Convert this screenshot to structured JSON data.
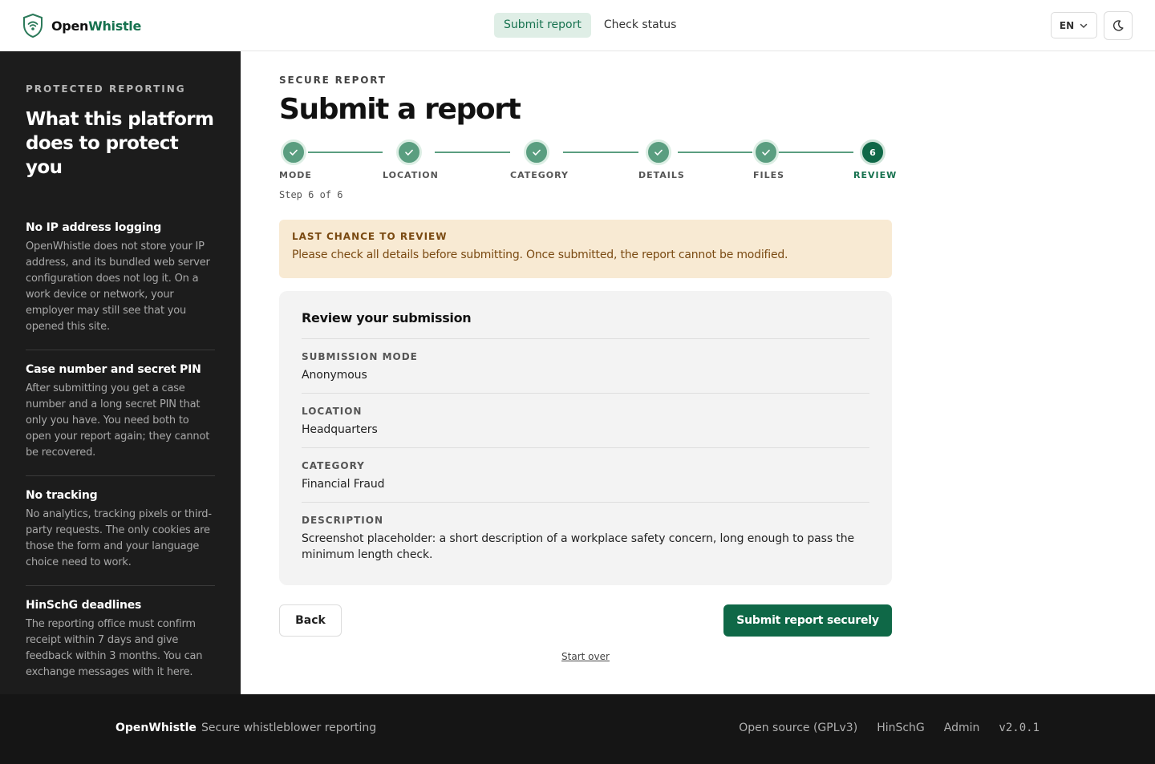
{
  "header": {
    "brand_part1": "Open",
    "brand_part2": "Whistle",
    "logo_icon": "shield-wifi-icon",
    "nav": [
      {
        "label": "Submit report",
        "active": true
      },
      {
        "label": "Check status",
        "active": false
      }
    ],
    "language": "EN",
    "theme_icon": "moon-icon"
  },
  "sidebar": {
    "eyebrow": "PROTECTED REPORTING",
    "title": "What this platform does to protect you",
    "items": [
      {
        "title": "No IP address logging",
        "body": "OpenWhistle does not store your IP address, and its bundled web server configuration does not log it. On a work device or network, your employer may still see that you opened this site."
      },
      {
        "title": "Case number and secret PIN",
        "body": "After submitting you get a case number and a long secret PIN that only you have. You need both to open your report again; they cannot be recovered."
      },
      {
        "title": "No tracking",
        "body": "No analytics, tracking pixels or third-party requests. The only cookies are those the form and your language choice need to work."
      },
      {
        "title": "HinSchG deadlines",
        "body": "The reporting office must confirm receipt within 7 days and give feedback within 3 months. You can exchange messages with it here."
      }
    ]
  },
  "main": {
    "eyebrow": "SECURE REPORT",
    "title": "Submit a report",
    "steps": [
      {
        "label": "MODE",
        "state": "done"
      },
      {
        "label": "LOCATION",
        "state": "done"
      },
      {
        "label": "CATEGORY",
        "state": "done"
      },
      {
        "label": "DETAILS",
        "state": "done"
      },
      {
        "label": "FILES",
        "state": "done"
      },
      {
        "label": "REVIEW",
        "state": "current",
        "number": "6"
      }
    ],
    "step_count": "Step 6 of 6",
    "alert": {
      "title": "LAST CHANCE TO REVIEW",
      "body": "Please check all details before submitting. Once submitted, the report cannot be modified."
    },
    "review": {
      "title": "Review your submission",
      "rows": [
        {
          "label": "SUBMISSION MODE",
          "value": "Anonymous"
        },
        {
          "label": "LOCATION",
          "value": "Headquarters"
        },
        {
          "label": "CATEGORY",
          "value": "Financial Fraud"
        },
        {
          "label": "DESCRIPTION",
          "value": "Screenshot placeholder: a short description of a workplace safety concern, long enough to pass the minimum length check."
        }
      ]
    },
    "back_label": "Back",
    "submit_label": "Submit report securely",
    "start_over_label": "Start over"
  },
  "footer": {
    "brand": "OpenWhistle",
    "tagline": "Secure whistleblower reporting",
    "links": [
      "Open source (GPLv3)",
      "HinSchG",
      "Admin"
    ],
    "version": "v2.0.1"
  },
  "colors": {
    "accent": "#0f6847",
    "accent_light": "#5a9e80",
    "sidebar_bg": "#1c1c1c",
    "alert_bg": "#f8ead3"
  }
}
